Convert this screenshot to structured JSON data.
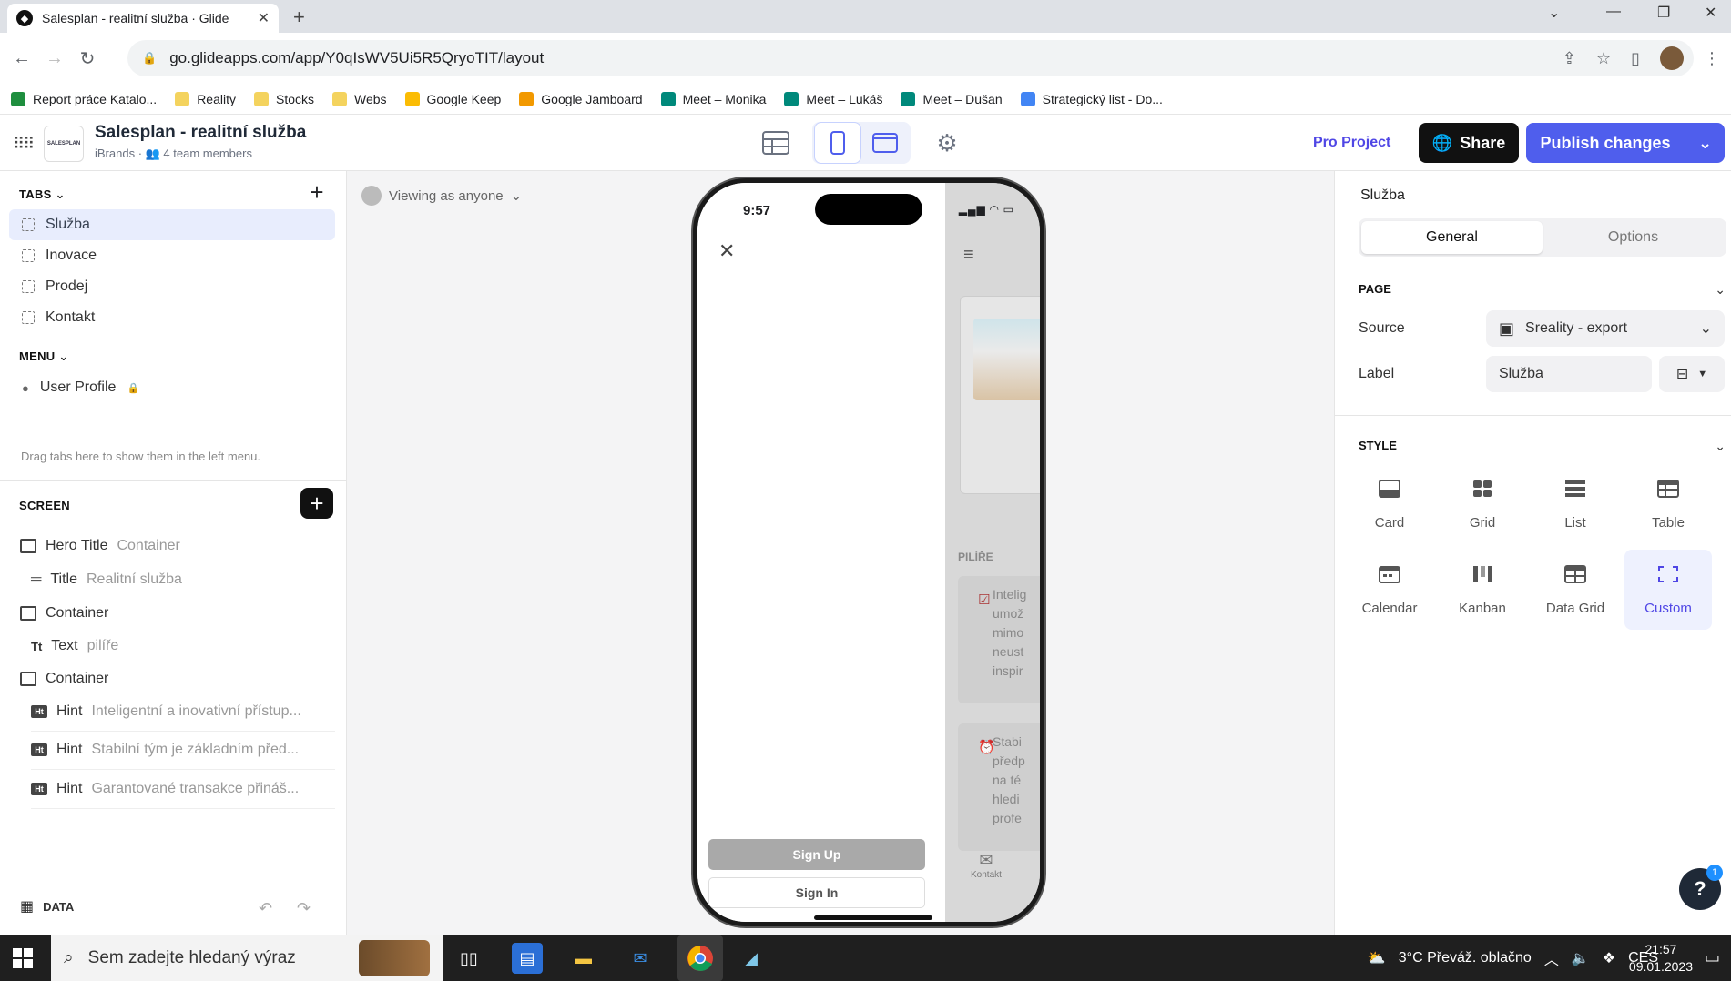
{
  "browser": {
    "tab_title": "Salesplan - realitní služba · Glide",
    "url": "go.glideapps.com/app/Y0qIsWV5Ui5R5QryoTIT/layout",
    "bookmarks": [
      {
        "label": "Report práce Katalo...",
        "color": "#1e8e3e"
      },
      {
        "label": "Reality",
        "color": "#f4d35e"
      },
      {
        "label": "Stocks",
        "color": "#f4d35e"
      },
      {
        "label": "Webs",
        "color": "#f4d35e"
      },
      {
        "label": "Google Keep",
        "color": "#fbbc04"
      },
      {
        "label": "Google Jamboard",
        "color": "#f29900"
      },
      {
        "label": "Meet – Monika",
        "color": "#00897b"
      },
      {
        "label": "Meet – Lukáš",
        "color": "#00897b"
      },
      {
        "label": "Meet – Dušan",
        "color": "#00897b"
      },
      {
        "label": "Strategický list - Do...",
        "color": "#4285f4"
      }
    ]
  },
  "header": {
    "logo_text": "SALESPLAN",
    "title": "Salesplan - realitní služba",
    "subtitle": "iBrands · 👥 4 team members",
    "pro_project": "Pro Project",
    "share": "Share",
    "publish": "Publish changes"
  },
  "left": {
    "tabs_heading": "TABS",
    "tabs": [
      "Služba",
      "Inovace",
      "Prodej",
      "Kontakt"
    ],
    "menu_heading": "MENU",
    "menu_item": "User Profile",
    "menu_hint": "Drag tabs here to show them in the left menu.",
    "screen_heading": "SCREEN",
    "components": [
      {
        "type": "Hero Title",
        "sub": "Container"
      },
      {
        "type": "Title",
        "sub": "Realitní služba"
      },
      {
        "type": "Container",
        "sub": ""
      },
      {
        "type": "Text",
        "sub": "pilíře"
      },
      {
        "type": "Container",
        "sub": ""
      },
      {
        "type": "Hint",
        "sub": "Inteligentní a inovativní přístup..."
      },
      {
        "type": "Hint",
        "sub": "Stabilní tým je základním před..."
      },
      {
        "type": "Hint",
        "sub": "Garantované transakce přináš..."
      }
    ],
    "data_label": "DATA"
  },
  "canvas": {
    "viewing_as": "Viewing as anyone",
    "phone_time": "9:57",
    "section_label": "PILÍŘE",
    "hint1_lines": [
      "Intelig",
      "umož",
      "mimo",
      "neust",
      "inspir"
    ],
    "hint2_lines": [
      "Stabi",
      "předp",
      "na té",
      "hledi",
      "profe"
    ],
    "kontakt": "Kontakt",
    "signup": "Sign Up",
    "signin": "Sign In"
  },
  "right": {
    "title": "Služba",
    "seg_general": "General",
    "seg_options": "Options",
    "page_heading": "PAGE",
    "source_label": "Source",
    "source_value": "Sreality - export",
    "label_label": "Label",
    "label_value": "Služba",
    "style_heading": "STYLE",
    "styles": [
      "Card",
      "Grid",
      "List",
      "Table",
      "Calendar",
      "Kanban",
      "Data Grid",
      "Custom"
    ],
    "selected_style": "Custom",
    "help_badge": "1"
  },
  "taskbar": {
    "search_placeholder": "Sem zadejte hledaný výraz",
    "weather": "3°C  Převáž. oblačno",
    "lang": "CES",
    "time": "21:57",
    "date": "09.01.2023"
  },
  "colors": {
    "accent": "#4f5eed",
    "selected_bg": "#e8edfd"
  }
}
